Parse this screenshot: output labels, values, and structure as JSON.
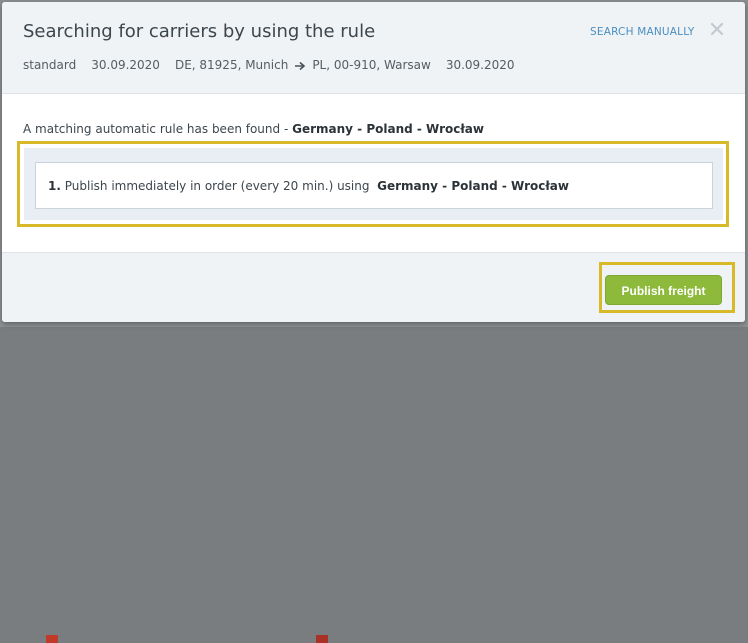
{
  "modal": {
    "title": "Searching for carriers by using the rule",
    "search_manually_label": "SEARCH MANUALLY",
    "close_icon": "close-icon"
  },
  "freight": {
    "type": "standard",
    "pickup_date": "30.09.2020",
    "origin": "DE, 81925, Munich",
    "destination": "PL, 00-910, Warsaw",
    "delivery_date": "30.09.2020",
    "arrow_icon": "arrow-right-icon"
  },
  "rule_found": {
    "prefix": "A matching automatic rule has been found - ",
    "rule_name": "Germany - Poland - Wrocław"
  },
  "rules": [
    {
      "number": "1.",
      "description": "Publish immediately in order (every 20 min.) using",
      "rule_name": "Germany - Poland - Wrocław"
    }
  ],
  "footer": {
    "publish_label": "Publish freight"
  },
  "colors": {
    "accent_green": "#8dba3a",
    "highlight_yellow": "#d8b92a",
    "link_blue": "#4b8ec0"
  }
}
